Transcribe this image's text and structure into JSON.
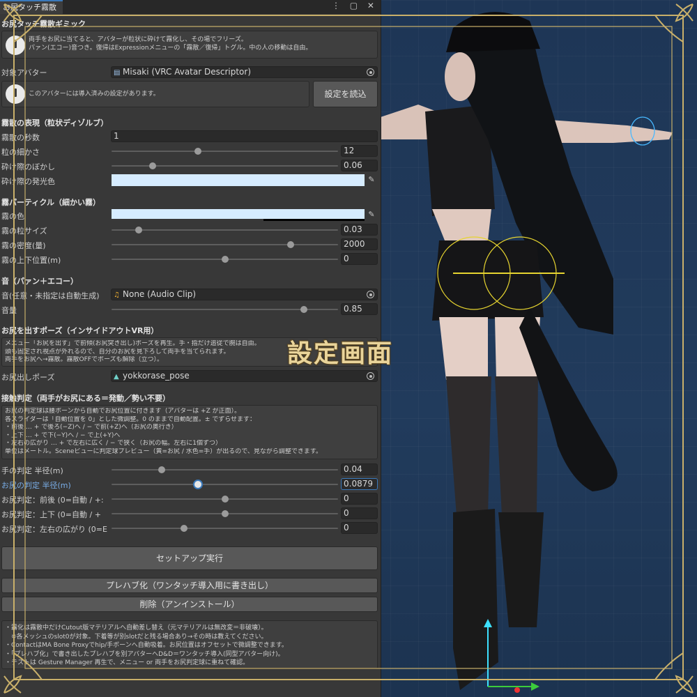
{
  "window": {
    "tab_title": "お尻タッチ霧散",
    "tab_icons": "⋮ ▢ ✕",
    "main_title": "お尻タッチ霧散ギミック"
  },
  "intro_help": {
    "lines": [
      "両手をお尻に当てると、アバターが粒状に砕けて霧化し、その場でフリーズ。",
      "パァン(エコー)音つき。復帰はExpressionメニューの「霧散／復帰」トグル。中の人の移動は自由。"
    ]
  },
  "avatar": {
    "label": "対象アバター",
    "value": "Misaki (VRC Avatar Descriptor)",
    "notice": "このアバターには導入済みの設定があります。",
    "load_button": "設定を読込"
  },
  "dissolve": {
    "header": "霧散の表現（粒状ディゾルブ）",
    "seconds_label": "霧散の秒数",
    "seconds_value": "1",
    "grain_label": "粒の細かさ",
    "grain_value": "12",
    "grain_fraction": 0.38,
    "blur_label": "砕け際のぼかし",
    "blur_value": "0.06",
    "blur_fraction": 0.18,
    "glow_label": "砕け際の発光色",
    "glow_color": "#d6ecff"
  },
  "fog": {
    "header": "霧パーティクル（細かい霧）",
    "color_label": "霧の色",
    "color": "#d6ecff",
    "size_label": "霧の粒サイズ",
    "size_value": "0.03",
    "size_fraction": 0.12,
    "density_label": "霧の密度(量)",
    "density_value": "2000",
    "density_fraction": 0.79,
    "height_label": "霧の上下位置(m)",
    "height_value": "0",
    "height_fraction": 0.5
  },
  "sound": {
    "header": "音（パァン＋エコー）",
    "clip_label": "音(任意・未指定は自動生成)",
    "clip_value": "None (Audio Clip)",
    "volume_label": "音量",
    "volume_value": "0.85",
    "volume_fraction": 0.85
  },
  "pose": {
    "header": "お尻を出すポーズ（インサイドアウトVR用）",
    "help_lines": [
      "メニュー「お尻を出す」で前傾(お尻突き出し)ポーズを再生。手・指だけ追従で腕は自由。",
      "頭も固定され視点が外れるので、自分のお尻を見下ろして両手を当てられます。",
      "両手をお尻へ→霧散。霧散OFFでポーズも解除（立つ）。"
    ],
    "pose_label": "お尻出しポーズ",
    "pose_value": "yokkorase_pose"
  },
  "contact": {
    "header": "接触判定（両手がお尻にある＝発動／勢い不要）",
    "help_lines": [
      "お尻の判定球は腰ボーンから自動でお尻位置に付きます（アバターは +Z が正面）。",
      "各スライダーは「自動位置を 0」とした微調整。0 のままで自動配置。± でずらせます：",
      "・前後 … + で後ろ(−Z)へ / − で前(+Z)へ（お尻の奥行き）",
      "・上下 … + で下(−Y)へ / − で上(+Y)へ",
      "・左右の広がり … + で左右に広く / − で狭く（お尻の幅。左右に1個ずつ）",
      "単位はメートル。Sceneビューに判定球プレビュー（黄=お尻 / 水色=手）が出るので、見ながら調整できます。"
    ],
    "hand_label": "手の判定 半径(m)",
    "hand_value": "0.04",
    "hand_fraction": 0.22,
    "butt_label": "お尻の判定 半径(m)",
    "butt_value": "0.0879",
    "butt_fraction": 0.38,
    "fb_label": "お尻判定：前後 (0=自動 / +:",
    "fb_value": "0",
    "fb_fraction": 0.5,
    "ud_label": "お尻判定：上下 (0=自動 / +",
    "ud_value": "0",
    "ud_fraction": 0.5,
    "lr_label": "お尻判定：左右の広がり (0=E",
    "lr_value": "0",
    "lr_fraction": 0.32
  },
  "actions": {
    "setup": "セットアップ実行",
    "prefab": "プレハブ化（ワンタッチ導入用に書き出し）",
    "remove": "削除（アンインストール）"
  },
  "footer_help": {
    "lines": [
      "・霧化は霧散中だけCutout版マテリアルへ自動差し替え（元マテリアルは無改変＝非破壊）。",
      "　※各メッシュのslot0が対象。下着等が別slotだと残る場合あり→その時は教えてください。",
      "・ContactはMA Bone Proxyでhip/手ボーンへ自動吸着。お尻位置はオフセットで微調整できます。",
      "・「プレハブ化」で書き出したプレハブを別アバターへD&D＝ワンタッチ導入(同型アバター向け)。",
      "・テストは Gesture Manager 再生で、メニュー or 両手をお尻判定球に重ねて確認。"
    ]
  },
  "overlay": {
    "banner": "設定画面",
    "frame_color": "#c9b06a"
  }
}
